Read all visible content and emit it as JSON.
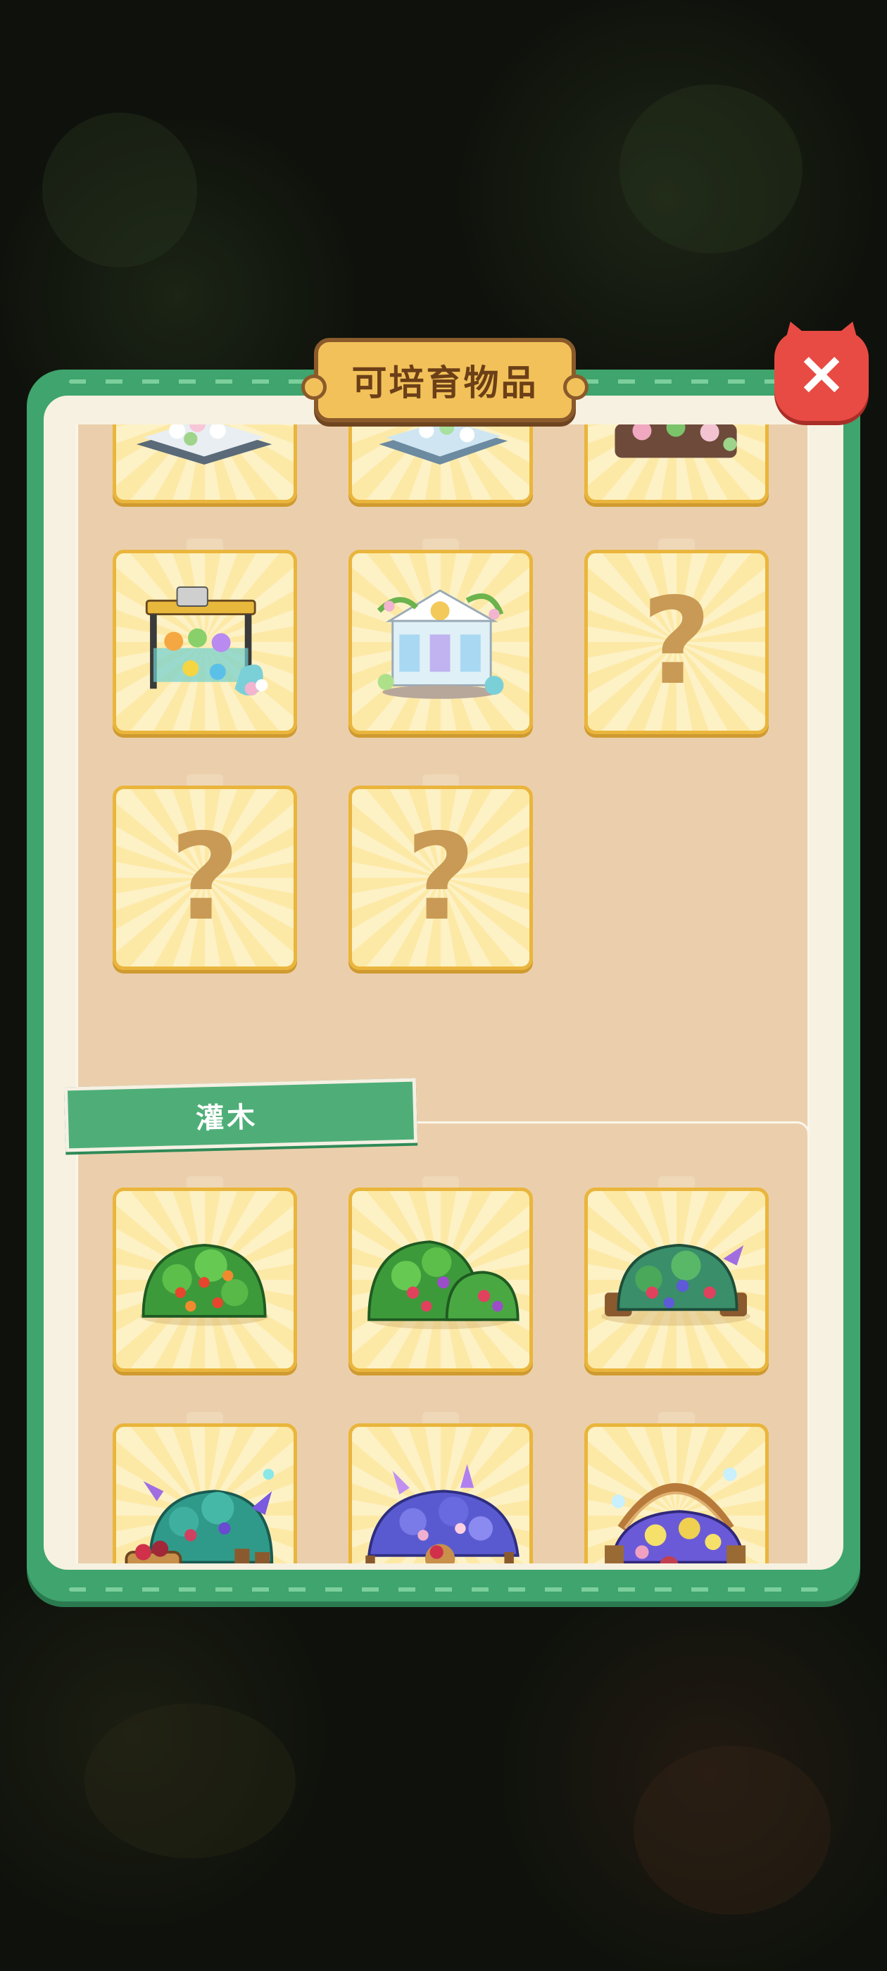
{
  "dialog": {
    "title": "可培育物品",
    "close_label": "×"
  },
  "sections": [
    {
      "name": "",
      "items": [
        {
          "state": "unlocked",
          "icon": "white-flower-stand-icon"
        },
        {
          "state": "unlocked",
          "icon": "flower-display-icon"
        },
        {
          "state": "unlocked",
          "icon": "pink-flower-cart-icon"
        },
        {
          "state": "unlocked",
          "icon": "flower-shop-stall-icon"
        },
        {
          "state": "unlocked",
          "icon": "greenhouse-pavilion-icon"
        },
        {
          "state": "locked",
          "text": "?"
        },
        {
          "state": "locked",
          "text": "?"
        },
        {
          "state": "locked",
          "text": "?"
        }
      ]
    },
    {
      "name": "灌木",
      "items": [
        {
          "state": "unlocked",
          "icon": "berry-bush-icon"
        },
        {
          "state": "unlocked",
          "icon": "double-berry-bush-icon"
        },
        {
          "state": "unlocked",
          "icon": "stump-berry-bush-icon"
        },
        {
          "state": "unlocked",
          "icon": "basket-berry-bush-icon"
        },
        {
          "state": "unlocked",
          "icon": "fenced-berry-bush-icon"
        },
        {
          "state": "unlocked",
          "icon": "arch-berry-garden-icon"
        }
      ]
    }
  ],
  "colors": {
    "panel_green": "#3fa46d",
    "panel_cream": "#f7f1e1",
    "section_tan": "#ebcfac",
    "slot_border": "#e9b53c",
    "close_red": "#e84b43",
    "title_gold": "#f2c15a"
  }
}
